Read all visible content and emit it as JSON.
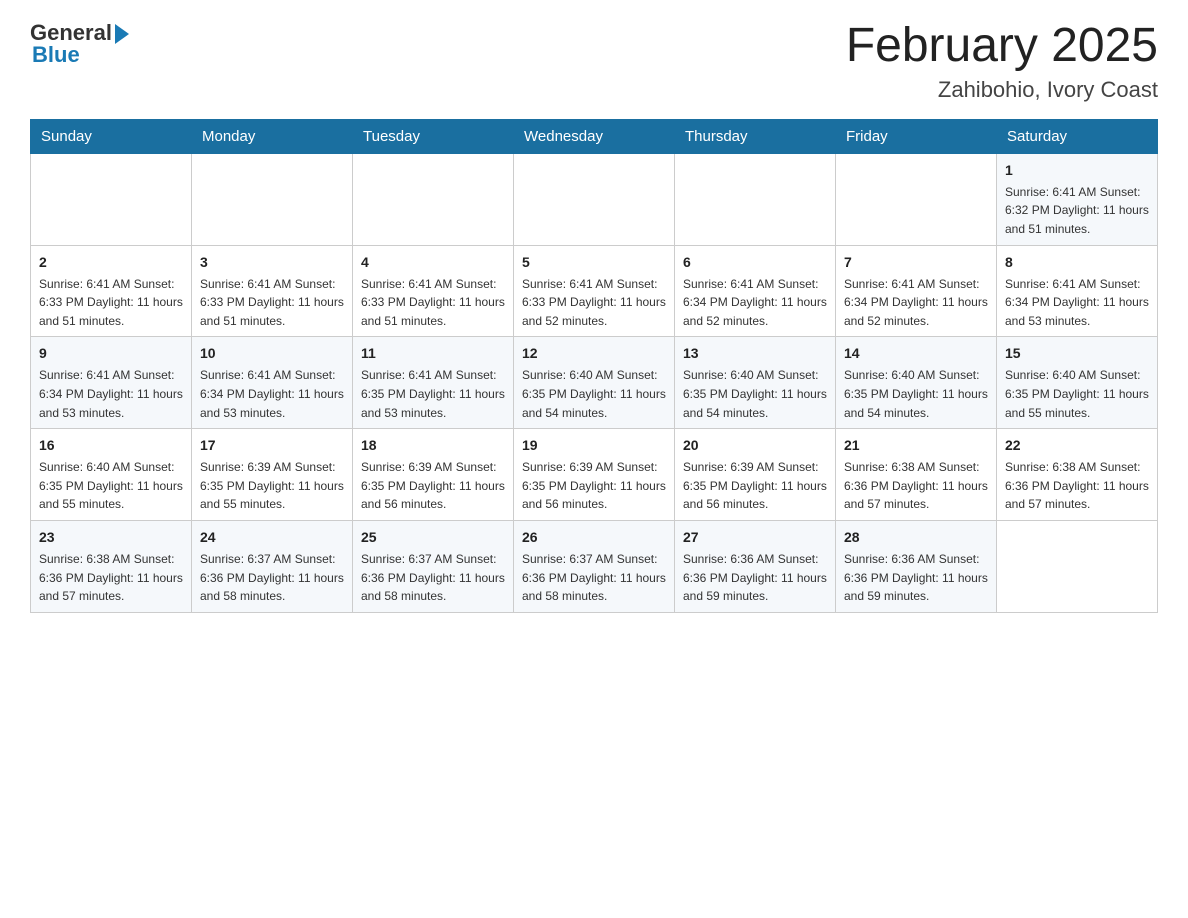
{
  "header": {
    "logo_general": "General",
    "logo_blue": "Blue",
    "title": "February 2025",
    "subtitle": "Zahibohio, Ivory Coast"
  },
  "weekdays": [
    "Sunday",
    "Monday",
    "Tuesday",
    "Wednesday",
    "Thursday",
    "Friday",
    "Saturday"
  ],
  "weeks": [
    [
      {
        "day": "",
        "info": ""
      },
      {
        "day": "",
        "info": ""
      },
      {
        "day": "",
        "info": ""
      },
      {
        "day": "",
        "info": ""
      },
      {
        "day": "",
        "info": ""
      },
      {
        "day": "",
        "info": ""
      },
      {
        "day": "1",
        "info": "Sunrise: 6:41 AM\nSunset: 6:32 PM\nDaylight: 11 hours and 51 minutes."
      }
    ],
    [
      {
        "day": "2",
        "info": "Sunrise: 6:41 AM\nSunset: 6:33 PM\nDaylight: 11 hours and 51 minutes."
      },
      {
        "day": "3",
        "info": "Sunrise: 6:41 AM\nSunset: 6:33 PM\nDaylight: 11 hours and 51 minutes."
      },
      {
        "day": "4",
        "info": "Sunrise: 6:41 AM\nSunset: 6:33 PM\nDaylight: 11 hours and 51 minutes."
      },
      {
        "day": "5",
        "info": "Sunrise: 6:41 AM\nSunset: 6:33 PM\nDaylight: 11 hours and 52 minutes."
      },
      {
        "day": "6",
        "info": "Sunrise: 6:41 AM\nSunset: 6:34 PM\nDaylight: 11 hours and 52 minutes."
      },
      {
        "day": "7",
        "info": "Sunrise: 6:41 AM\nSunset: 6:34 PM\nDaylight: 11 hours and 52 minutes."
      },
      {
        "day": "8",
        "info": "Sunrise: 6:41 AM\nSunset: 6:34 PM\nDaylight: 11 hours and 53 minutes."
      }
    ],
    [
      {
        "day": "9",
        "info": "Sunrise: 6:41 AM\nSunset: 6:34 PM\nDaylight: 11 hours and 53 minutes."
      },
      {
        "day": "10",
        "info": "Sunrise: 6:41 AM\nSunset: 6:34 PM\nDaylight: 11 hours and 53 minutes."
      },
      {
        "day": "11",
        "info": "Sunrise: 6:41 AM\nSunset: 6:35 PM\nDaylight: 11 hours and 53 minutes."
      },
      {
        "day": "12",
        "info": "Sunrise: 6:40 AM\nSunset: 6:35 PM\nDaylight: 11 hours and 54 minutes."
      },
      {
        "day": "13",
        "info": "Sunrise: 6:40 AM\nSunset: 6:35 PM\nDaylight: 11 hours and 54 minutes."
      },
      {
        "day": "14",
        "info": "Sunrise: 6:40 AM\nSunset: 6:35 PM\nDaylight: 11 hours and 54 minutes."
      },
      {
        "day": "15",
        "info": "Sunrise: 6:40 AM\nSunset: 6:35 PM\nDaylight: 11 hours and 55 minutes."
      }
    ],
    [
      {
        "day": "16",
        "info": "Sunrise: 6:40 AM\nSunset: 6:35 PM\nDaylight: 11 hours and 55 minutes."
      },
      {
        "day": "17",
        "info": "Sunrise: 6:39 AM\nSunset: 6:35 PM\nDaylight: 11 hours and 55 minutes."
      },
      {
        "day": "18",
        "info": "Sunrise: 6:39 AM\nSunset: 6:35 PM\nDaylight: 11 hours and 56 minutes."
      },
      {
        "day": "19",
        "info": "Sunrise: 6:39 AM\nSunset: 6:35 PM\nDaylight: 11 hours and 56 minutes."
      },
      {
        "day": "20",
        "info": "Sunrise: 6:39 AM\nSunset: 6:35 PM\nDaylight: 11 hours and 56 minutes."
      },
      {
        "day": "21",
        "info": "Sunrise: 6:38 AM\nSunset: 6:36 PM\nDaylight: 11 hours and 57 minutes."
      },
      {
        "day": "22",
        "info": "Sunrise: 6:38 AM\nSunset: 6:36 PM\nDaylight: 11 hours and 57 minutes."
      }
    ],
    [
      {
        "day": "23",
        "info": "Sunrise: 6:38 AM\nSunset: 6:36 PM\nDaylight: 11 hours and 57 minutes."
      },
      {
        "day": "24",
        "info": "Sunrise: 6:37 AM\nSunset: 6:36 PM\nDaylight: 11 hours and 58 minutes."
      },
      {
        "day": "25",
        "info": "Sunrise: 6:37 AM\nSunset: 6:36 PM\nDaylight: 11 hours and 58 minutes."
      },
      {
        "day": "26",
        "info": "Sunrise: 6:37 AM\nSunset: 6:36 PM\nDaylight: 11 hours and 58 minutes."
      },
      {
        "day": "27",
        "info": "Sunrise: 6:36 AM\nSunset: 6:36 PM\nDaylight: 11 hours and 59 minutes."
      },
      {
        "day": "28",
        "info": "Sunrise: 6:36 AM\nSunset: 6:36 PM\nDaylight: 11 hours and 59 minutes."
      },
      {
        "day": "",
        "info": ""
      }
    ]
  ]
}
